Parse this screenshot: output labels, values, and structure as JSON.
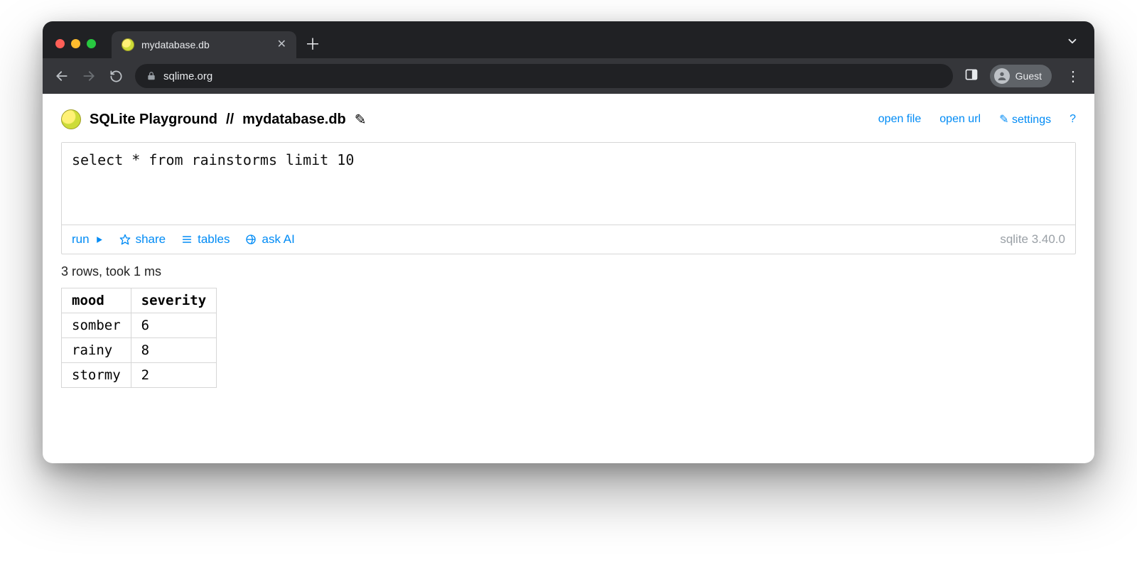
{
  "browser": {
    "tab_title": "mydatabase.db",
    "url_display": "sqlime.org",
    "profile_label": "Guest"
  },
  "header": {
    "app_title": "SQLite Playground",
    "separator": "//",
    "db_name": "mydatabase.db",
    "edit_icon": "✎",
    "links": {
      "open_file": "open file",
      "open_url": "open url",
      "settings_icon": "✎",
      "settings": "settings",
      "help": "?"
    }
  },
  "editor": {
    "query": "select * from rainstorms limit 10",
    "toolbar": {
      "run": "run",
      "share": "share",
      "tables": "tables",
      "ask_ai": "ask AI"
    },
    "version": "sqlite 3.40.0"
  },
  "status": "3 rows, took 1 ms",
  "result": {
    "columns": [
      "mood",
      "severity"
    ],
    "rows": [
      [
        "somber",
        "6"
      ],
      [
        "rainy",
        "8"
      ],
      [
        "stormy",
        "2"
      ]
    ]
  }
}
